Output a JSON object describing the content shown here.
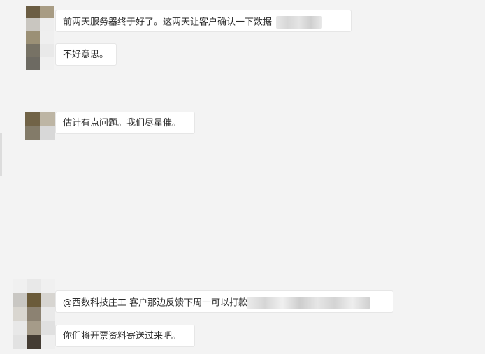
{
  "messages": [
    {
      "id": "m1",
      "text": "前两天服务器终于好了。这两天让客户确认一下数据"
    },
    {
      "id": "m2",
      "text": "不好意思。"
    },
    {
      "id": "m3",
      "text": "估计有点问题。我们尽量催。"
    },
    {
      "id": "m4",
      "text": "@西数科技庄工 客户那边反馈下周一可以打款"
    },
    {
      "id": "m5",
      "text": "你们将开票资料寄送过来吧。"
    }
  ],
  "colors": {
    "background": "#f3f3f3",
    "bubble": "#ffffff",
    "bubble_border": "#e6e6e6",
    "text": "#2b2b2b"
  }
}
